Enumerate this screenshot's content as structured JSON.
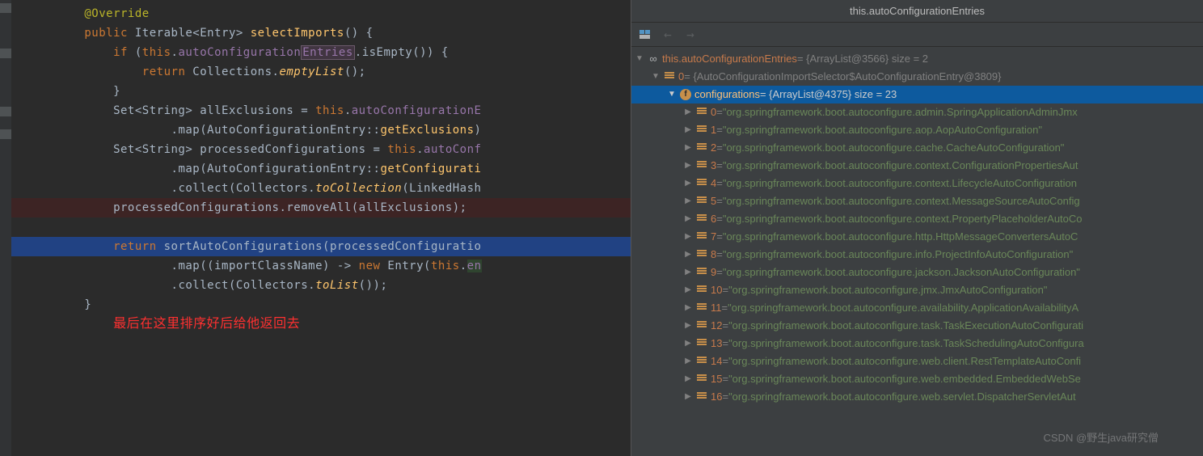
{
  "debugTitle": "this.autoConfigurationEntries",
  "code": {
    "l1_annotation": "@Override",
    "l2_public": "public",
    "l2_type": " Iterable<Entry> ",
    "l2_method": "selectImports",
    "l2_rest": "() {",
    "l3_if": "if",
    "l3_a": " (",
    "l3_this": "this",
    "l3_b": ".",
    "l3_field1": "autoConfiguration",
    "l3_field2": "Entries",
    "l3_c": ".isEmpty()) {",
    "l4_return": "return",
    "l4_a": " Collections.",
    "l4_method": "emptyList",
    "l4_b": "();",
    "l5": "}",
    "l6_a": "Set<String> allExclusions = ",
    "l6_this": "this",
    "l6_b": ".",
    "l6_field": "autoConfigurationE",
    "l7_a": ".map(AutoConfigurationEntry::",
    "l7_method": "getExclusions",
    "l7_b": ")",
    "l8_a": "Set<String> processedConfigurations = ",
    "l8_this": "this",
    "l8_b": ".",
    "l8_field": "autoConf",
    "l9_a": ".map(AutoConfigurationEntry::",
    "l9_method": "getConfigurati",
    "l10_a": ".collect(Collectors.",
    "l10_method": "toCollection",
    "l10_b": "(LinkedHash",
    "l11": "processedConfigurations.removeAll(allExclusions);",
    "l12_return": "return",
    "l12_a": " sortAutoConfigurations(processedConfiguratio",
    "l13_a": ".map((importClassName) -> ",
    "l13_new": "new",
    "l13_b": " Entry(",
    "l13_this": "this",
    "l13_c": ".",
    "l13_field": "en",
    "l14_a": ".collect(Collectors.",
    "l14_method": "toList",
    "l14_b": "());",
    "l15": "}",
    "note": "最后在这里排序好后给他返回去"
  },
  "debugRoot": {
    "name": "this.autoConfigurationEntries",
    "value": " = {ArrayList@3566}  size = 2"
  },
  "debugL1": {
    "name": "0",
    "value": " = {AutoConfigurationImportSelector$AutoConfigurationEntry@3809}"
  },
  "debugL2": {
    "name": "configurations",
    "value": " = {ArrayList@4375}  size = 23"
  },
  "configs": [
    {
      "idx": "0",
      "val": "\"org.springframework.boot.autoconfigure.admin.SpringApplicationAdminJmx"
    },
    {
      "idx": "1",
      "val": "\"org.springframework.boot.autoconfigure.aop.AopAutoConfiguration\""
    },
    {
      "idx": "2",
      "val": "\"org.springframework.boot.autoconfigure.cache.CacheAutoConfiguration\""
    },
    {
      "idx": "3",
      "val": "\"org.springframework.boot.autoconfigure.context.ConfigurationPropertiesAut"
    },
    {
      "idx": "4",
      "val": "\"org.springframework.boot.autoconfigure.context.LifecycleAutoConfiguration"
    },
    {
      "idx": "5",
      "val": "\"org.springframework.boot.autoconfigure.context.MessageSourceAutoConfig"
    },
    {
      "idx": "6",
      "val": "\"org.springframework.boot.autoconfigure.context.PropertyPlaceholderAutoCo"
    },
    {
      "idx": "7",
      "val": "\"org.springframework.boot.autoconfigure.http.HttpMessageConvertersAutoC"
    },
    {
      "idx": "8",
      "val": "\"org.springframework.boot.autoconfigure.info.ProjectInfoAutoConfiguration\""
    },
    {
      "idx": "9",
      "val": "\"org.springframework.boot.autoconfigure.jackson.JacksonAutoConfiguration\""
    },
    {
      "idx": "10",
      "val": "\"org.springframework.boot.autoconfigure.jmx.JmxAutoConfiguration\""
    },
    {
      "idx": "11",
      "val": "\"org.springframework.boot.autoconfigure.availability.ApplicationAvailabilityA"
    },
    {
      "idx": "12",
      "val": "\"org.springframework.boot.autoconfigure.task.TaskExecutionAutoConfigurati"
    },
    {
      "idx": "13",
      "val": "\"org.springframework.boot.autoconfigure.task.TaskSchedulingAutoConfigura"
    },
    {
      "idx": "14",
      "val": "\"org.springframework.boot.autoconfigure.web.client.RestTemplateAutoConfi"
    },
    {
      "idx": "15",
      "val": "\"org.springframework.boot.autoconfigure.web.embedded.EmbeddedWebSe"
    },
    {
      "idx": "16",
      "val": "\"org.springframework.boot.autoconfigure.web.servlet.DispatcherServletAut"
    }
  ],
  "watermark": "CSDN @野生java研究僧"
}
